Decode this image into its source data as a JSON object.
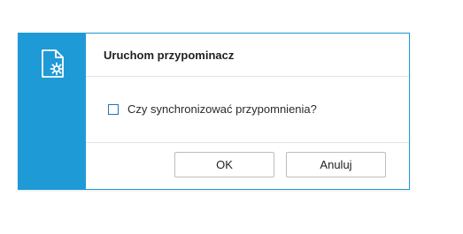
{
  "dialog": {
    "title": "Uruchom przypominacz",
    "sidebar_icon": "document-gear-icon",
    "checkbox": {
      "label": "Czy synchronizować przypomnienia?",
      "checked": false
    },
    "buttons": {
      "ok_label": "OK",
      "cancel_label": "Anuluj"
    }
  },
  "colors": {
    "accent": "#1e9ad6",
    "checkbox_border": "#1e73b8",
    "button_border": "#bdbdbd",
    "divider": "#e3e3e3"
  }
}
